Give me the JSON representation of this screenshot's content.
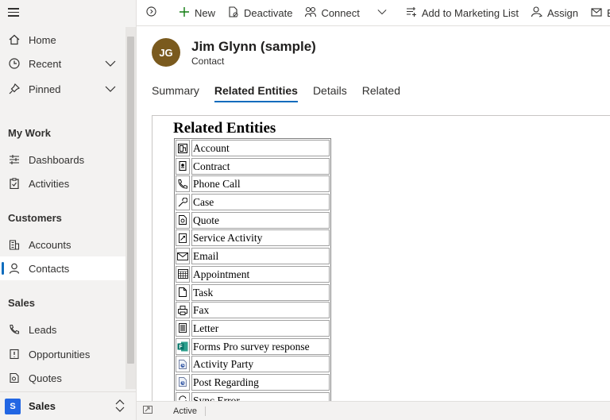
{
  "sidebar": {
    "items": [
      {
        "label": "Home",
        "icon": "home-icon"
      },
      {
        "label": "Recent",
        "icon": "clock-icon"
      },
      {
        "label": "Pinned",
        "icon": "pin-icon"
      },
      {
        "label": "Dashboards",
        "icon": "dashboard-icon"
      },
      {
        "label": "Activities",
        "icon": "clipboard-icon"
      },
      {
        "label": "Accounts",
        "icon": "building-icon"
      },
      {
        "label": "Contacts",
        "icon": "person-icon"
      },
      {
        "label": "Leads",
        "icon": "phone-person-icon"
      },
      {
        "label": "Opportunities",
        "icon": "opportunity-icon"
      },
      {
        "label": "Quotes",
        "icon": "quote-icon"
      }
    ],
    "groups": {
      "my_work": "My Work",
      "customers": "Customers",
      "sales": "Sales"
    },
    "area": {
      "badge": "S",
      "label": "Sales"
    }
  },
  "commandbar": {
    "new": "New",
    "deactivate": "Deactivate",
    "connect": "Connect",
    "add_to_marketing_list": "Add to Marketing List",
    "assign": "Assign",
    "email_partial": "Em"
  },
  "record": {
    "initials": "JG",
    "title": "Jim Glynn (sample)",
    "type": "Contact",
    "avatar_color": "#7a5a1e"
  },
  "tabs": [
    "Summary",
    "Related Entities",
    "Details",
    "Related"
  ],
  "frame": {
    "title": "Related Entities",
    "entities": [
      {
        "label": "Account",
        "icon": "account-icon"
      },
      {
        "label": "Contract",
        "icon": "contract-icon"
      },
      {
        "label": "Phone Call",
        "icon": "phone-icon"
      },
      {
        "label": "Case",
        "icon": "wrench-icon"
      },
      {
        "label": "Quote",
        "icon": "quote-icon"
      },
      {
        "label": "Service Activity",
        "icon": "service-activity-icon"
      },
      {
        "label": "Email",
        "icon": "email-icon"
      },
      {
        "label": "Appointment",
        "icon": "calendar-icon"
      },
      {
        "label": "Task",
        "icon": "task-icon"
      },
      {
        "label": "Fax",
        "icon": "fax-icon"
      },
      {
        "label": "Letter",
        "icon": "letter-icon"
      },
      {
        "label": "Forms Pro survey response",
        "icon": "forms-pro-icon"
      },
      {
        "label": "Activity Party",
        "icon": "activity-party-icon"
      },
      {
        "label": "Post Regarding",
        "icon": "post-regarding-icon"
      },
      {
        "label": "Sync Error",
        "icon": "sync-error-icon"
      }
    ]
  },
  "status": {
    "text": "Active"
  },
  "colors": {
    "accent": "#0f6cbd",
    "area_badge": "#2266e3",
    "forms_pro": "#077568"
  }
}
